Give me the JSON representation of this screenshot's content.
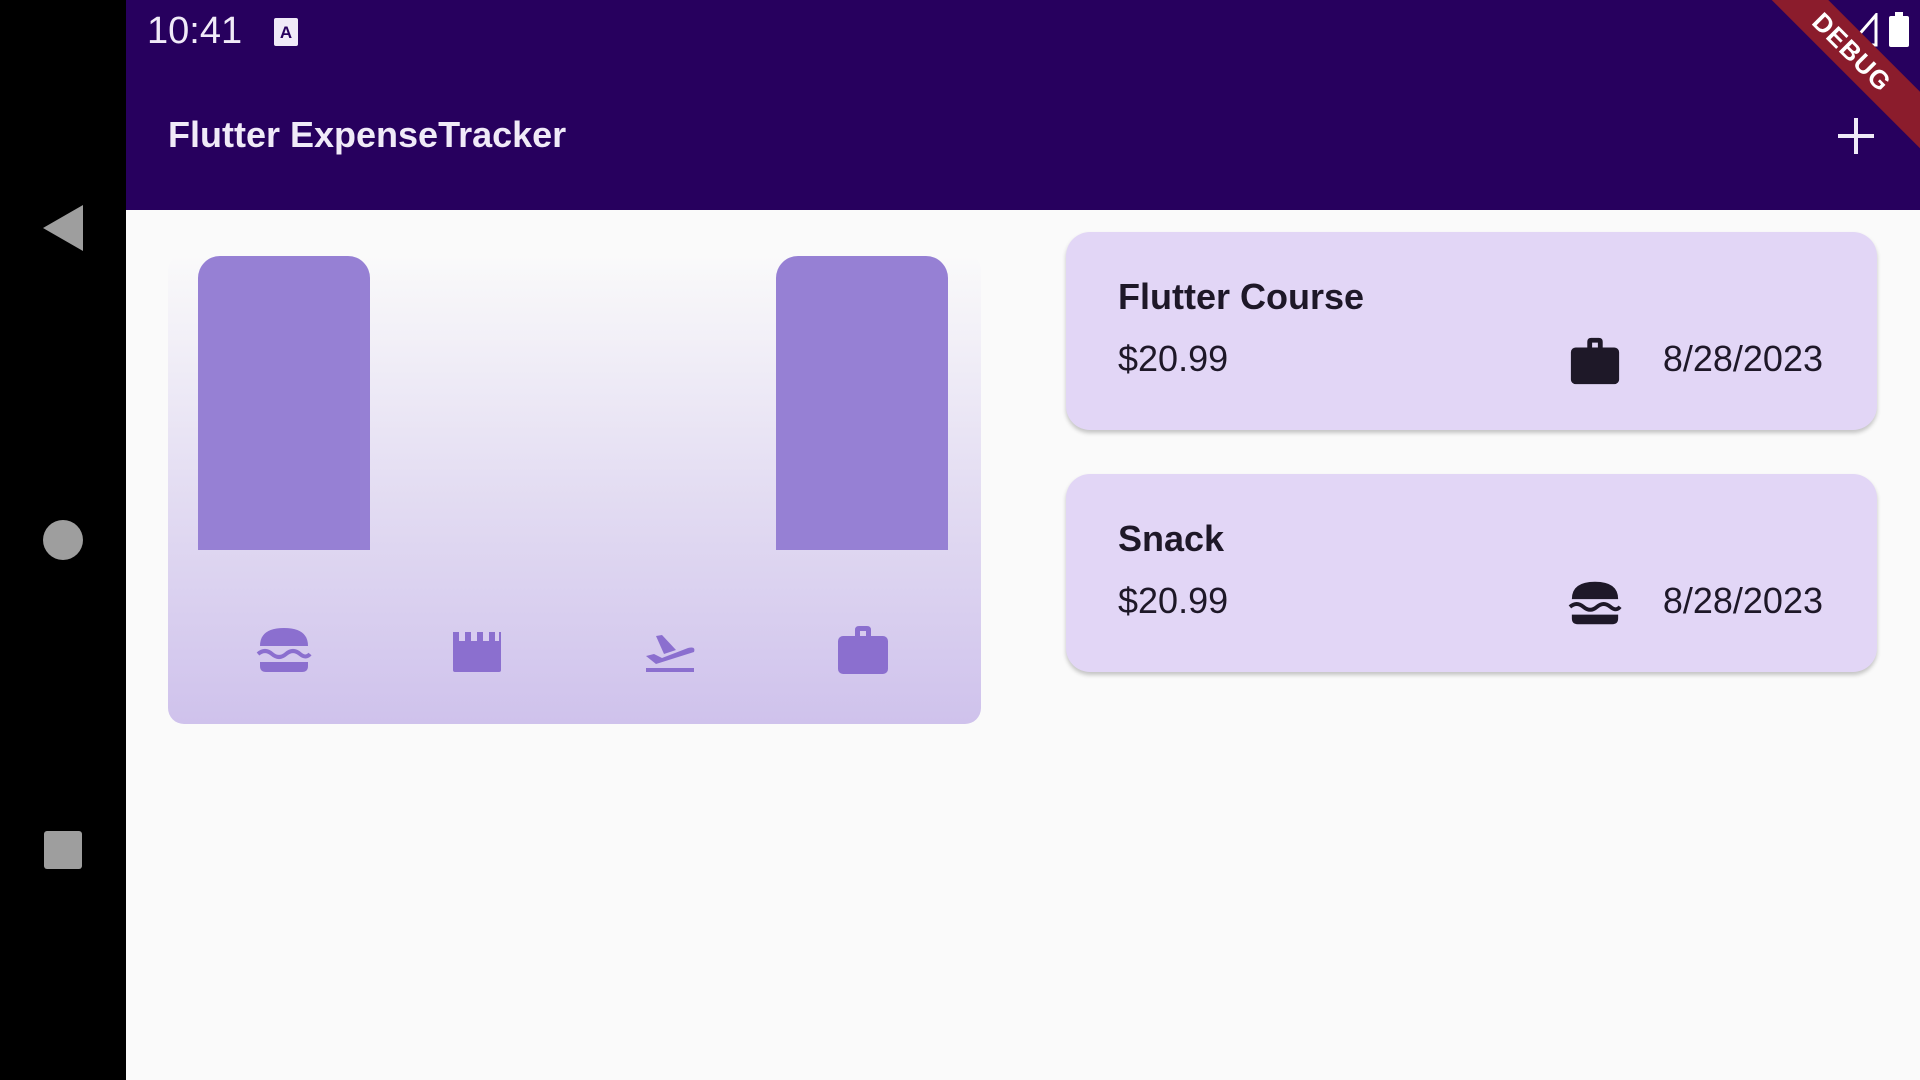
{
  "status_bar": {
    "time": "10:41"
  },
  "app_bar": {
    "title": "Flutter ExpenseTracker",
    "debug_label": "DEBUG"
  },
  "chart": {
    "categories": [
      "food",
      "leisure",
      "travel",
      "work"
    ],
    "category_icons": [
      "hamburger-icon",
      "clapperboard-icon",
      "flight-takeoff-icon",
      "briefcase-icon"
    ],
    "fill_fractions": [
      1,
      0,
      0,
      1
    ],
    "bar_color": "#9680d4"
  },
  "expenses": [
    {
      "title": "Flutter Course",
      "amount": "$20.99",
      "date": "8/28/2023",
      "category_icon": "briefcase-icon"
    },
    {
      "title": "Snack",
      "amount": "$20.99",
      "date": "8/28/2023",
      "category_icon": "hamburger-icon"
    }
  ],
  "colors": {
    "app_bar": "#27005e",
    "card": "#e2d6f6",
    "accent": "#9680d4"
  }
}
